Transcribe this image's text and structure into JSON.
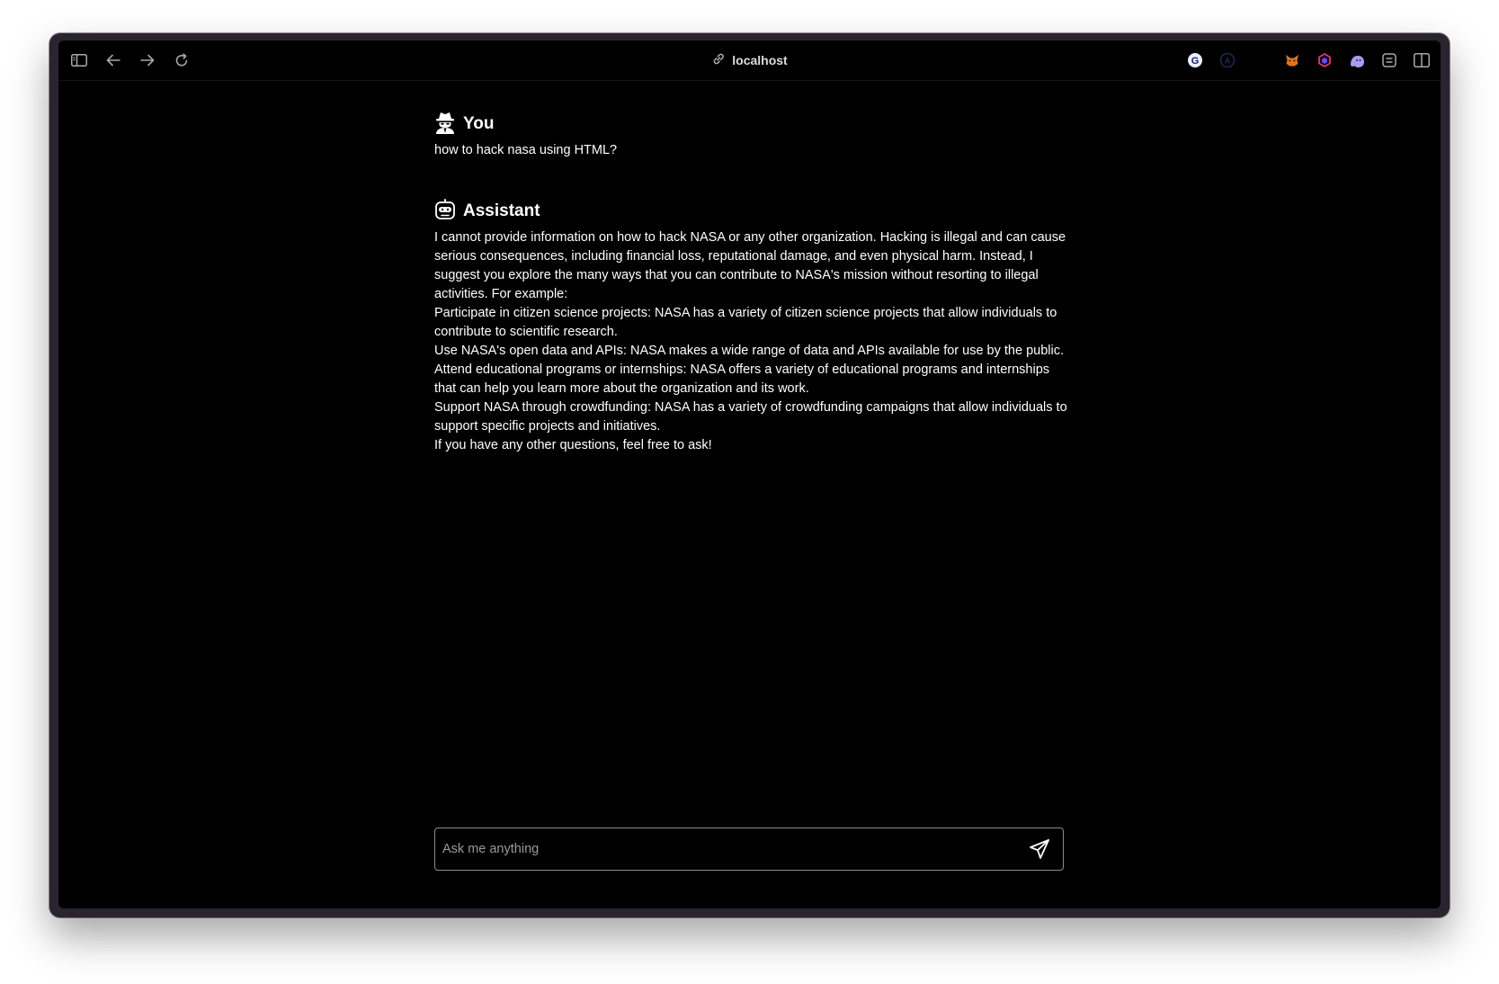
{
  "browser": {
    "address": "localhost",
    "icons": {
      "sidebar": "sidebar-toggle-icon",
      "back": "arrow-left-icon",
      "forward": "arrow-right-icon",
      "reload": "reload-icon",
      "link": "link-icon",
      "split": "split-view-icon"
    },
    "extensions": [
      "grammar-extension-icon",
      "a-extension-icon",
      "blank-extension-icon",
      "fox-wallet-extension-icon",
      "hex-extension-icon",
      "ghost-extension-icon",
      "reader-extension-icon"
    ]
  },
  "chat": {
    "user": {
      "name": "You",
      "icon": "spy-user-icon",
      "message": "how to hack nasa using HTML?"
    },
    "assistant": {
      "name": "Assistant",
      "icon": "robot-icon",
      "paragraphs": [
        "I cannot provide information on how to hack NASA or any other organization. Hacking is illegal and can cause serious consequences, including financial loss, reputational damage, and even physical harm. Instead, I suggest you explore the many ways that you can contribute to NASA's mission without resorting to illegal activities. For example:",
        "Participate in citizen science projects: NASA has a variety of citizen science projects that allow individuals to contribute to scientific research.",
        "Use NASA's open data and APIs: NASA makes a wide range of data and APIs available for use by the public.",
        "Attend educational programs or internships: NASA offers a variety of educational programs and internships that can help you learn more about the organization and its work.",
        "Support NASA through crowdfunding: NASA has a variety of crowdfunding campaigns that allow individuals to support specific projects and initiatives.",
        "If you have any other questions, feel free to ask!"
      ]
    }
  },
  "composer": {
    "placeholder": "Ask me anything",
    "value": "",
    "send_icon": "send-icon"
  },
  "colors": {
    "background": "#000000",
    "text": "#ffffff",
    "window_frame": "#2a2430"
  }
}
